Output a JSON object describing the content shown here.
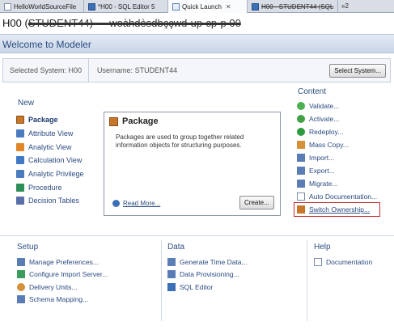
{
  "tabs": [
    {
      "label": "HelloWorldSourceFile",
      "icon": "file-icon"
    },
    {
      "label": "*H00 - SQL Editor 5",
      "icon": "sql-editor-icon"
    },
    {
      "label": "Quick Launch",
      "icon": "quick-launch-icon",
      "active": true,
      "close": "✕"
    },
    {
      "label": "H00 - STUDENT44 (SQL",
      "icon": "sql-editor-icon",
      "struck": true
    }
  ],
  "tab_overflow": "»2",
  "window_title": {
    "prefix": "H00 (",
    "redacted": "STUDENT44) — woàhdèsdbççwd·up·cp·p 00",
    "suffix": ""
  },
  "welcome": "Welcome to Modeler",
  "system": {
    "selected_label": "Selected System: H00",
    "username_label": "Username: STUDENT44",
    "select_button": "Select System..."
  },
  "new_section": {
    "title": "New",
    "items": [
      {
        "label": "Package",
        "icon": "package-icon",
        "color": "#c8762a",
        "active": true
      },
      {
        "label": "Attribute View",
        "icon": "attribute-view-icon",
        "color": "#4a7cc0"
      },
      {
        "label": "Analytic View",
        "icon": "analytic-view-icon",
        "color": "#e0872a"
      },
      {
        "label": "Calculation View",
        "icon": "calculation-view-icon",
        "color": "#3f7ac3"
      },
      {
        "label": "Analytic Privilege",
        "icon": "analytic-privilege-icon",
        "color": "#4a7cc0"
      },
      {
        "label": "Procedure",
        "icon": "procedure-icon",
        "color": "#2f8f5a"
      },
      {
        "label": "Decision Tables",
        "icon": "decision-tables-icon",
        "color": "#5b6fa8"
      }
    ]
  },
  "package_card": {
    "title": "Package",
    "description": "Packages are used to group together related information objects for structuring purposes.",
    "read_more": "Read More...",
    "create_button": "Create..."
  },
  "content_section": {
    "title": "Content",
    "items": [
      {
        "label": "Validate...",
        "icon": "validate-icon",
        "color": "#4caf50"
      },
      {
        "label": "Activate...",
        "icon": "activate-icon",
        "color": "#43a047"
      },
      {
        "label": "Redeploy...",
        "icon": "redeploy-icon",
        "color": "#2e9a3e"
      },
      {
        "label": "Mass Copy...",
        "icon": "mass-copy-icon",
        "color": "#d4913a"
      },
      {
        "label": "Import...",
        "icon": "import-icon",
        "color": "#5a7db5"
      },
      {
        "label": "Export...",
        "icon": "export-icon",
        "color": "#5a7db5"
      },
      {
        "label": "Migrate...",
        "icon": "migrate-icon",
        "color": "#5a7db5"
      },
      {
        "label": "Auto Documentation...",
        "icon": "auto-documentation-icon",
        "color": "#7a8bab"
      },
      {
        "label": "Switch Ownership...",
        "icon": "switch-ownership-icon",
        "color": "#c8762a",
        "highlighted": true
      }
    ],
    "highlight_color": "#c62828"
  },
  "setup_section": {
    "title": "Setup",
    "items": [
      {
        "label": "Manage Preferences...",
        "icon": "preferences-icon",
        "color": "#5a7db5"
      },
      {
        "label": "Configure Import Server...",
        "icon": "import-server-icon",
        "color": "#3a9d5d"
      },
      {
        "label": "Delivery Units...",
        "icon": "delivery-units-icon",
        "color": "#d4913a"
      },
      {
        "label": "Schema Mapping...",
        "icon": "schema-mapping-icon",
        "color": "#5a7db5"
      }
    ]
  },
  "data_section": {
    "title": "Data",
    "items": [
      {
        "label": "Generate Time Data...",
        "icon": "time-data-icon",
        "color": "#5a7db5"
      },
      {
        "label": "Data Provisioning...",
        "icon": "data-provisioning-icon",
        "color": "#5a7db5"
      },
      {
        "label": "SQL Editor",
        "icon": "sql-editor-icon",
        "color": "#3b6fb6"
      }
    ]
  },
  "help_section": {
    "title": "Help",
    "items": [
      {
        "label": "Documentation",
        "icon": "documentation-icon",
        "color": "#7a8bab"
      }
    ]
  }
}
